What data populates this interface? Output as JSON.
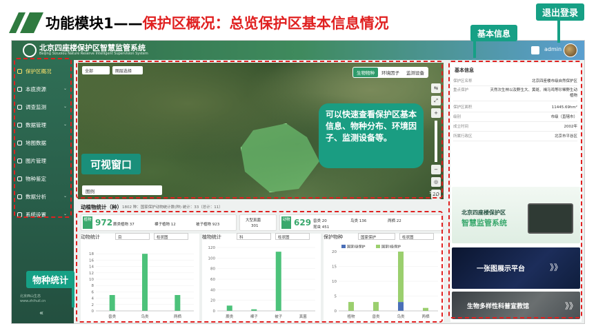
{
  "slide": {
    "title_prefix": "功能模块1——",
    "title_highlight": "保护区概况：总览保护区基本信息情况"
  },
  "callouts": {
    "logout": "退出登录",
    "basic_info": "基本信息",
    "species_stats": "物种统计",
    "visual_window": "可视窗口",
    "feature_desc": "可以快速查看保护区基本信息、物种分布、环境因子、监测设备等。"
  },
  "header": {
    "title": "北京四座楼保护区智慧监管系统",
    "subtitle": "Beijing Sizuolou Nature Reserve Intelligent Supervision System",
    "user": "admin"
  },
  "sidebar": {
    "items": [
      {
        "label": "保护区概况",
        "active": true
      },
      {
        "label": "本底资源"
      },
      {
        "label": "调查监测"
      },
      {
        "label": "数据管理"
      },
      {
        "label": "地图数据"
      },
      {
        "label": "图片管理"
      },
      {
        "label": "物种鉴定"
      },
      {
        "label": "数据分析"
      },
      {
        "label": "系统设置"
      }
    ],
    "footer_line1": "北京西山生态",
    "footer_line2": "www.zhihuil.cn"
  },
  "map": {
    "select1": "全部",
    "select2": "图层选择",
    "tabs": [
      "生物物种",
      "环境因子",
      "监测设备"
    ],
    "active_tab": "生物物种",
    "legend": "图例",
    "scale": "50米",
    "tools": [
      "⇆",
      "⤢",
      "+",
      "−",
      "◎",
      "2D"
    ]
  },
  "stats": {
    "title": "动植物统计（种）",
    "subtitle": "1802    种：国家保护动物统计数(种)    统计：33（总计：11）",
    "plant_badge": "植物",
    "plant_total": "972",
    "plant_items": [
      "蕨类植物 37",
      "裸子植物 12",
      "被子植物 923"
    ],
    "fungi_label": "大型真菌",
    "fungi_value": "301",
    "animal_badge": "动物",
    "animal_total": "629",
    "animal_items": [
      "兽类 20",
      "鸟类 136",
      "两栖 22",
      "昆虫 451"
    ]
  },
  "charts": {
    "animal": {
      "label": "动物统计",
      "sel1": "目",
      "sel2": "柱状图"
    },
    "plant": {
      "label": "植物统计",
      "sel1": "科",
      "sel2": "柱状图"
    },
    "protect": {
      "label": "保护物种",
      "sel1": "国家保护",
      "sel2": "柱状图"
    }
  },
  "chart_data": [
    {
      "type": "bar",
      "title": "动物统计",
      "categories": [
        "兽类",
        "鸟类",
        "两栖"
      ],
      "values": [
        5,
        18,
        5
      ],
      "ylim": [
        0,
        20
      ],
      "yticks": [
        0,
        2,
        4,
        6,
        8,
        10,
        12,
        14,
        16,
        18
      ],
      "color": "#4cc27a"
    },
    {
      "type": "bar",
      "title": "植物统计",
      "categories": [
        "蕨类",
        "裸子",
        "被子",
        "真菌"
      ],
      "values": [
        10,
        3,
        112,
        0
      ],
      "ylim": [
        0,
        120
      ],
      "yticks": [
        0,
        20,
        40,
        60,
        80,
        100,
        120
      ],
      "color": "#4cc27a"
    },
    {
      "type": "bar",
      "title": "保护物种",
      "categories": [
        "植物",
        "兽类",
        "鸟类",
        "两栖"
      ],
      "series": [
        {
          "name": "国家I级保护",
          "values": [
            0,
            0,
            3,
            0
          ],
          "color": "#4a6fb8"
        },
        {
          "name": "国家II级保护",
          "values": [
            3,
            3,
            17,
            1
          ],
          "color": "#9bcf6e"
        }
      ],
      "ylim": [
        0,
        20
      ],
      "yticks": [
        0,
        5,
        10,
        15,
        20
      ]
    }
  ],
  "basic_info": {
    "title": "基本信息",
    "rows": [
      {
        "k": "保护区名称",
        "v": "北京四座楼市级自然保护区"
      },
      {
        "k": "重点保护",
        "v": "天然次生林以及野生大、黄斑、褐马鸡等珍稀野生动植物"
      },
      {
        "k": "保护区面积",
        "v": "11445.69hm²"
      },
      {
        "k": "级别",
        "v": "市级（直辖市）"
      },
      {
        "k": "成立时间",
        "v": "2002年"
      },
      {
        "k": "所属行政区",
        "v": "北京市平谷区"
      }
    ]
  },
  "promos": {
    "p1_line1": "北京四座楼保护区",
    "p1_line2": "智慧监管系统",
    "p2": "一张图展示平台",
    "p3": "生物多样性科普宣教馆",
    "arrow": "》》"
  },
  "colors": {
    "accent": "#3aa86d",
    "callout": "#16a085",
    "highlight": "#e02020"
  }
}
